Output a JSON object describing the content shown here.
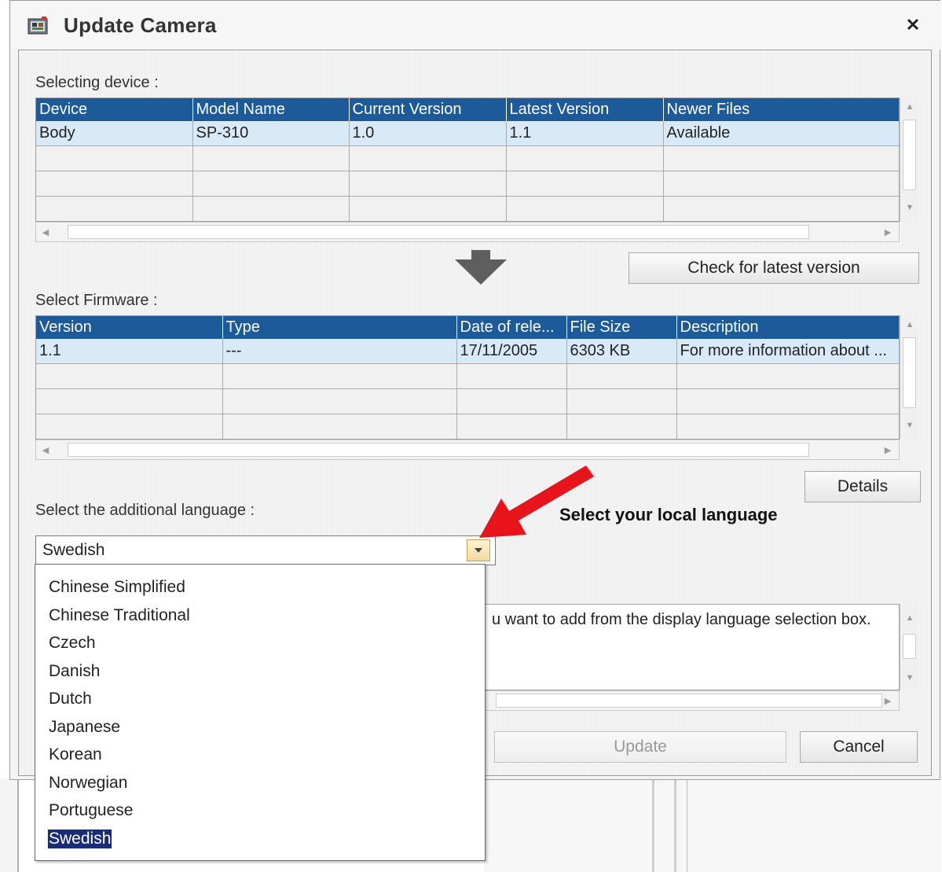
{
  "window": {
    "title": "Update Camera",
    "close_symbol": "✕"
  },
  "device_section": {
    "label": "Selecting device :",
    "columns": [
      "Device",
      "Model Name",
      "Current Version",
      "Latest Version",
      "Newer Files"
    ],
    "rows": [
      [
        "Body",
        "SP-310",
        "1.0",
        "1.1",
        "Available"
      ]
    ],
    "check_button": "Check for latest version"
  },
  "firmware_section": {
    "label": "Select Firmware :",
    "columns": [
      "Version",
      "Type",
      "Date of rele...",
      "File Size",
      "Description"
    ],
    "rows": [
      [
        "1.1",
        "---",
        "17/11/2005",
        "6303 KB",
        "For more information about ..."
      ]
    ],
    "details_button": "Details"
  },
  "language_section": {
    "label": "Select the additional language :",
    "selected": "Swedish",
    "options": [
      "Chinese Simplified",
      "Chinese Traditional",
      "Czech",
      "Danish",
      "Dutch",
      "Japanese",
      "Korean",
      "Norwegian",
      "Portuguese",
      "Swedish"
    ],
    "description_visible": "u want to add from the display language selection box."
  },
  "annotation": {
    "text": "Select your local language",
    "color": "#e8141c"
  },
  "footer": {
    "update_button": "Update",
    "cancel_button": "Cancel"
  },
  "colors": {
    "header_blue": "#1c5a9a",
    "selected_row": "#d8eaf8",
    "list_highlight": "#1a2c78"
  }
}
